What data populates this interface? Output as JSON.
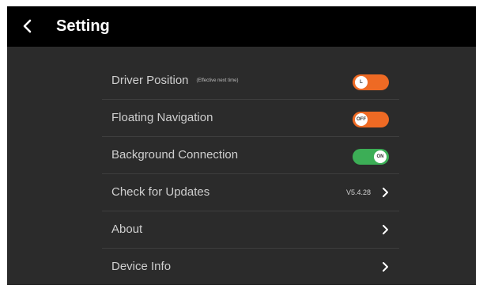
{
  "header": {
    "title": "Setting",
    "back_icon": "chevron-left-icon"
  },
  "colors": {
    "toggle_orange": "#ee6a24",
    "toggle_green": "#3cae56",
    "background": "#2b2b2b",
    "topbar": "#000000"
  },
  "settings": {
    "driver_position": {
      "label": "Driver Position",
      "note": "(Effective next time)",
      "toggle_text": "L",
      "toggle_state": "left"
    },
    "floating_navigation": {
      "label": "Floating Navigation",
      "toggle_text": "OFF",
      "toggle_state": "off"
    },
    "background_connection": {
      "label": "Background Connection",
      "toggle_text": "ON",
      "toggle_state": "on"
    },
    "check_for_updates": {
      "label": "Check for Updates",
      "version": "V5.4.28"
    },
    "about": {
      "label": "About"
    },
    "device_info": {
      "label": "Device Info"
    }
  }
}
